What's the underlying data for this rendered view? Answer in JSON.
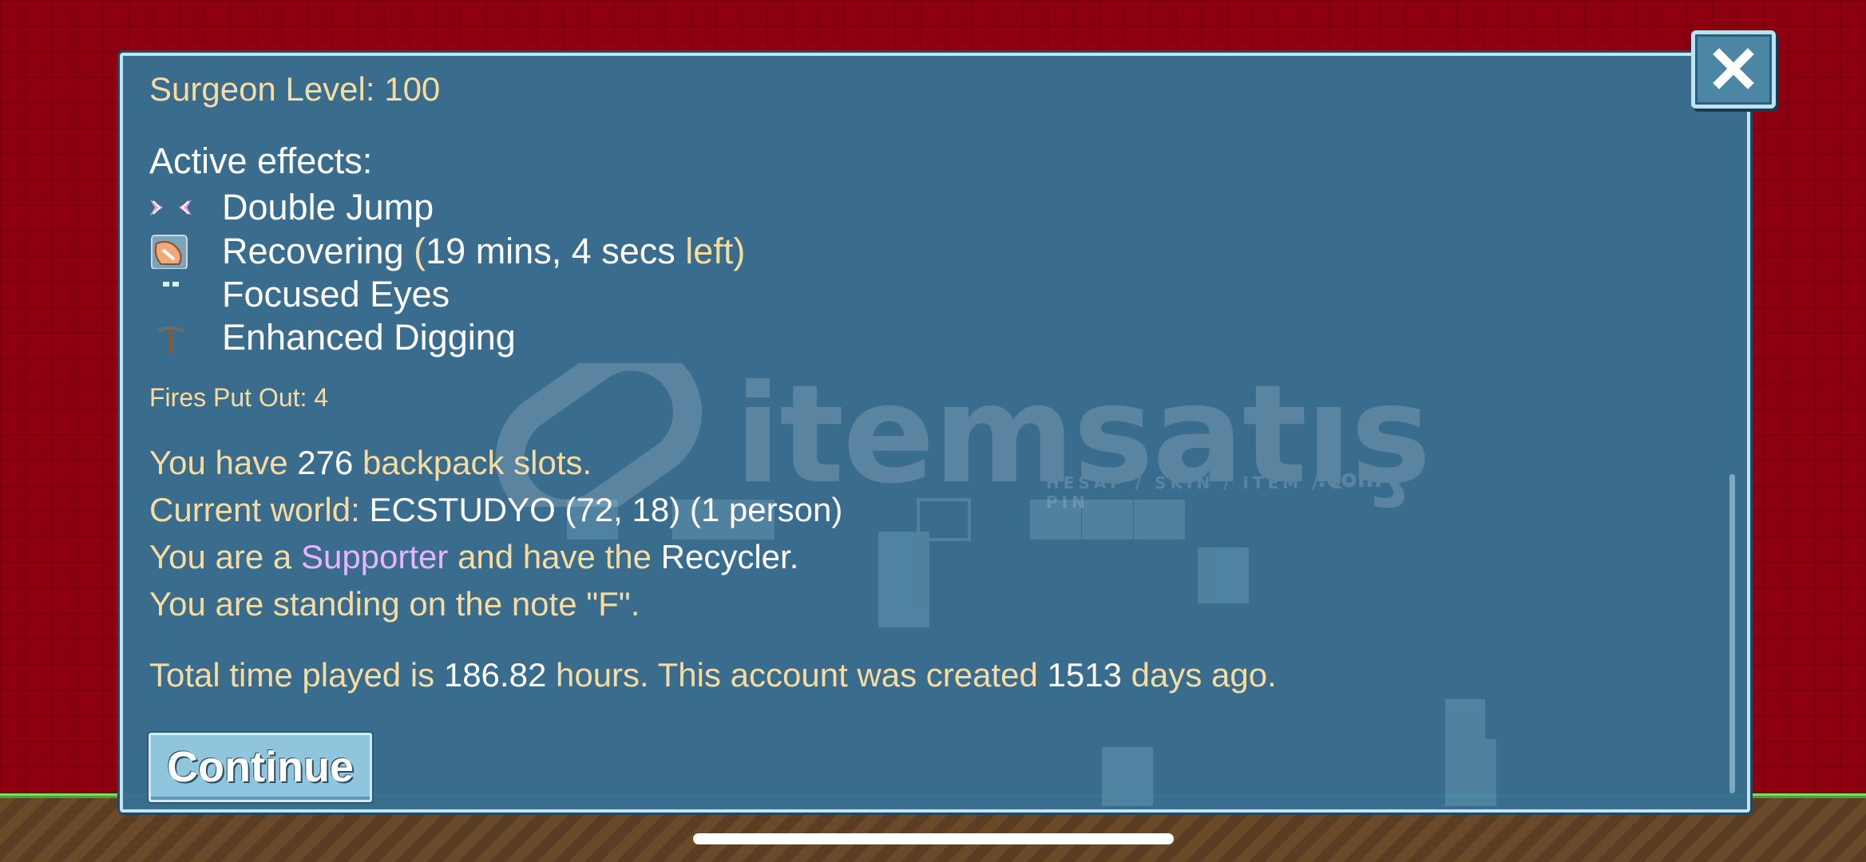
{
  "dialog": {
    "title_label": "Surgeon Level:",
    "title_value": "100",
    "effects_heading": "Active effects:",
    "effects": [
      {
        "icon": "double-jump-icon",
        "name": "Double Jump"
      },
      {
        "icon": "recovering-icon",
        "name": "Recovering",
        "paren_open": "(",
        "detail": "19 mins, 4 secs",
        "left_word": "left",
        "paren_close": ")"
      },
      {
        "icon": "focused-eyes-icon",
        "name": "Focused Eyes"
      },
      {
        "icon": "pickaxe-icon",
        "name": "Enhanced Digging"
      }
    ],
    "fires_put_out": "Fires Put Out: 4",
    "backpack": {
      "pre": "You have",
      "value": "276",
      "post": "backpack slots."
    },
    "world": {
      "pre": "Current world:",
      "name": "ECSTUDYO (72, 18)",
      "count": "(1 person)"
    },
    "status": {
      "pre": "You are a",
      "role": "Supporter",
      "mid": "and have the",
      "item": "Recycler",
      "end": "."
    },
    "note": "You are standing on the note \"F\".",
    "playtime": {
      "p1": "Total time played is",
      "hours": "186.82",
      "p2": "hours.  This account was created",
      "days": "1513",
      "p3": "days ago."
    },
    "continue_label": "Continue",
    "close_icon": "close-icon"
  },
  "watermark": {
    "text": "itemsatış",
    "sub": "HESAP / SKIN / ITEM / E-PIN",
    "dotcom": ".com"
  },
  "colors": {
    "panel": "#387092",
    "gold_text": "#f6dca1",
    "white_text": "#ffffff",
    "supporter": "#e9b3ff",
    "background": "#8d0011"
  }
}
